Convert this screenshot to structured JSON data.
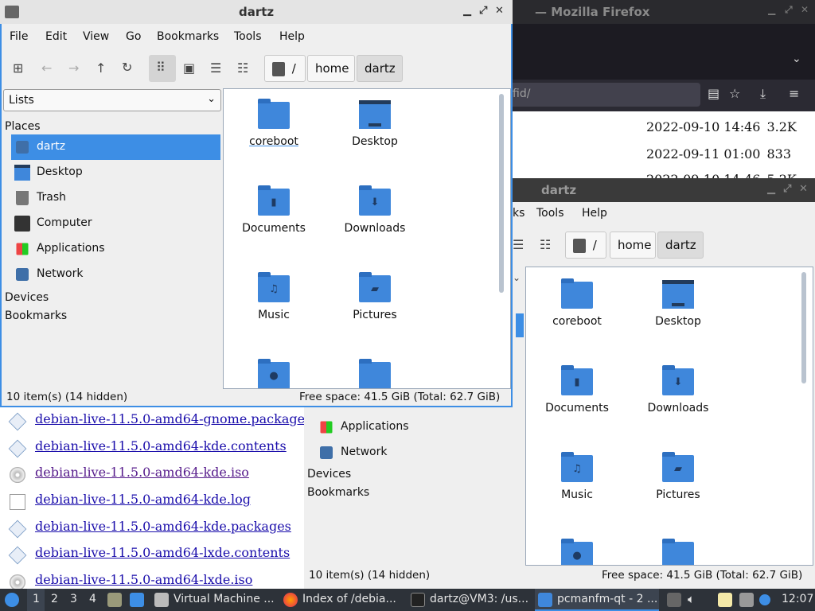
{
  "firefox": {
    "title": "— Mozilla Firefox",
    "url_fragment": "fid/",
    "listing_rows": [
      {
        "date": "2022-09-10 14:46",
        "size": "3.2K"
      },
      {
        "date": "2022-09-11 01:00",
        "size": "833"
      },
      {
        "date": "2022-09-10 14:46",
        "size": "5.2K"
      }
    ],
    "files": [
      {
        "name": "debian-live-11.5.0-amd64-gnome.packages",
        "icon": "package-icon"
      },
      {
        "name": "debian-live-11.5.0-amd64-kde.contents",
        "icon": "package-icon"
      },
      {
        "name": "debian-live-11.5.0-amd64-kde.iso",
        "icon": "disc-icon",
        "visited": true
      },
      {
        "name": "debian-live-11.5.0-amd64-kde.log",
        "icon": "text-file-icon"
      },
      {
        "name": "debian-live-11.5.0-amd64-kde.packages",
        "icon": "package-icon"
      },
      {
        "name": "debian-live-11.5.0-amd64-lxde.contents",
        "icon": "package-icon"
      },
      {
        "name": "debian-live-11.5.0-amd64-lxde.iso",
        "icon": "disc-icon"
      }
    ]
  },
  "fm_front": {
    "title": "dartz",
    "menu": [
      "File",
      "Edit",
      "View",
      "Go",
      "Bookmarks",
      "Tools",
      "Help"
    ],
    "path": [
      "/",
      "home",
      "dartz"
    ],
    "side_combo": "Lists",
    "places_header": "Places",
    "places": [
      {
        "label": "dartz",
        "icon": "home-icon",
        "selected": true
      },
      {
        "label": "Desktop",
        "icon": "desktop-icon"
      },
      {
        "label": "Trash",
        "icon": "trash-icon"
      },
      {
        "label": "Computer",
        "icon": "computer-icon"
      },
      {
        "label": "Applications",
        "icon": "applications-icon"
      },
      {
        "label": "Network",
        "icon": "network-icon"
      }
    ],
    "devices_header": "Devices",
    "bookmarks_header": "Bookmarks",
    "items": [
      "coreboot",
      "Desktop",
      "Documents",
      "Downloads",
      "Music",
      "Pictures"
    ],
    "status_left": "10 item(s) (14 hidden)",
    "status_right": "Free space: 41.5 GiB (Total: 62.7 GiB)"
  },
  "fm_back": {
    "title": "dartz",
    "menu_partial": [
      "ks",
      "Tools",
      "Help"
    ],
    "path": [
      "/",
      "home",
      "dartz"
    ],
    "places": [
      {
        "label": "Applications",
        "icon": "applications-icon"
      },
      {
        "label": "Network",
        "icon": "network-icon"
      }
    ],
    "devices_header": "Devices",
    "bookmarks_header": "Bookmarks",
    "items": [
      "coreboot",
      "Desktop",
      "Documents",
      "Downloads",
      "Music",
      "Pictures"
    ],
    "status_left": "10 item(s) (14 hidden)",
    "status_right": "Free space: 41.5 GiB (Total: 62.7 GiB)"
  },
  "taskbar": {
    "desktops": [
      "1",
      "2",
      "3",
      "4"
    ],
    "tasks": [
      {
        "label": "Virtual Machine ...",
        "icon": "vm-icon"
      },
      {
        "label": "Index of /debia...",
        "icon": "firefox-icon"
      },
      {
        "label": "dartz@VM3: /us...",
        "icon": "terminal-icon"
      },
      {
        "label": "pcmanfm-qt - 2 ...",
        "icon": "folder-icon"
      }
    ],
    "clock": "12:07"
  }
}
